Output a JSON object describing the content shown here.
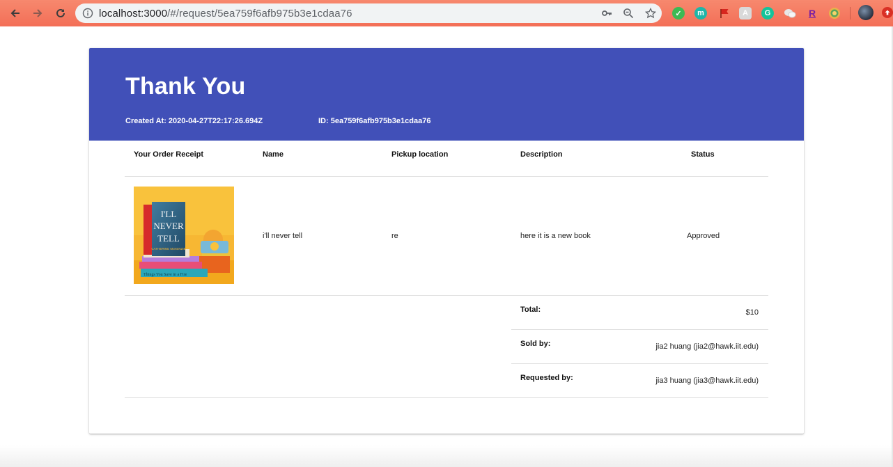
{
  "browser": {
    "url_host": "localhost:3000",
    "url_path": "/#/request/5ea759f6afb975b3e1cdaa76",
    "extensions": [
      "shield-check-icon",
      "m-extension-icon",
      "flag-icon",
      "translate-icon",
      "grammarly-icon",
      "chat-icon",
      "r-extension-icon",
      "target-icon"
    ]
  },
  "colors": {
    "chrome": "#f36f57",
    "header": "#4150b8"
  },
  "header": {
    "title": "Thank You",
    "created_at": "Created At: 2020-04-27T22:17:26.694Z",
    "id": "ID: 5ea759f6afb975b3e1cdaa76"
  },
  "table": {
    "columns": [
      "Your Order Receipt",
      "Name",
      "Pickup location",
      "Description",
      "Status"
    ],
    "row": {
      "image": "book-cover",
      "name": "i'll never tell",
      "pickup_location": "re",
      "description": "here it is a new book",
      "status": "Approved"
    },
    "book_cover": {
      "title_lines": [
        "I'LL",
        "NEVER",
        "TELL"
      ],
      "author": "CATHERINE McKENZIE",
      "spine_text": "Things You Save in a Fire"
    }
  },
  "summary": [
    {
      "label": "Total:",
      "value": "$10"
    },
    {
      "label": "Sold by:",
      "value": "jia2 huang (jia2@hawk.iit.edu)"
    },
    {
      "label": "Requested by:",
      "value": "jia3 huang (jia3@hawk.iit.edu)"
    }
  ]
}
